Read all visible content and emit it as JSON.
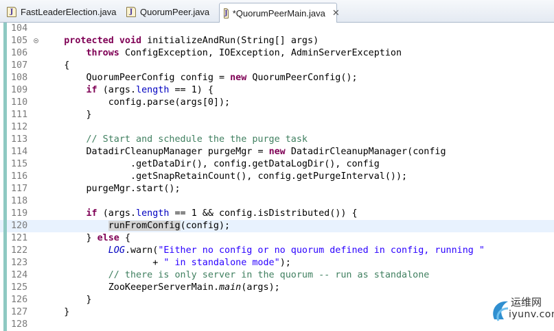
{
  "tabs": [
    {
      "label": "FastLeaderElection.java",
      "active": false
    },
    {
      "label": "QuorumPeer.java",
      "active": false
    },
    {
      "label": "*QuorumPeerMain.java",
      "active": true,
      "close": "✕"
    }
  ],
  "editor": {
    "current_line": "120",
    "fold_line": "105",
    "lines": [
      {
        "num": "104",
        "code": ""
      },
      {
        "num": "105",
        "code": "    protected void initializeAndRun(String[] args)"
      },
      {
        "num": "106",
        "code": "        throws ConfigException, IOException, AdminServerException"
      },
      {
        "num": "107",
        "code": "    {"
      },
      {
        "num": "108",
        "code": "        QuorumPeerConfig config = new QuorumPeerConfig();"
      },
      {
        "num": "109",
        "code": "        if (args.length == 1) {"
      },
      {
        "num": "110",
        "code": "            config.parse(args[0]);"
      },
      {
        "num": "111",
        "code": "        }"
      },
      {
        "num": "112",
        "code": ""
      },
      {
        "num": "113",
        "code": "        // Start and schedule the the purge task"
      },
      {
        "num": "114",
        "code": "        DatadirCleanupManager purgeMgr = new DatadirCleanupManager(config"
      },
      {
        "num": "115",
        "code": "                .getDataDir(), config.getDataLogDir(), config"
      },
      {
        "num": "116",
        "code": "                .getSnapRetainCount(), config.getPurgeInterval());"
      },
      {
        "num": "117",
        "code": "        purgeMgr.start();"
      },
      {
        "num": "118",
        "code": ""
      },
      {
        "num": "119",
        "code": "        if (args.length == 1 && config.isDistributed()) {"
      },
      {
        "num": "120",
        "code": "            runFromConfig(config);"
      },
      {
        "num": "121",
        "code": "        } else {"
      },
      {
        "num": "122",
        "code": "            LOG.warn(\"Either no config or no quorum defined in config, running \""
      },
      {
        "num": "123",
        "code": "                    + \" in standalone mode\");"
      },
      {
        "num": "124",
        "code": "            // there is only server in the quorum -- run as standalone"
      },
      {
        "num": "125",
        "code": "            ZooKeeperServerMain.main(args);"
      },
      {
        "num": "126",
        "code": "        }"
      },
      {
        "num": "127",
        "code": "    }"
      },
      {
        "num": "128",
        "code": ""
      }
    ]
  },
  "watermark": {
    "title": "运维网",
    "url": "iyunv.com"
  },
  "colors": {
    "keyword": "#7f0055",
    "comment": "#3f7f5f",
    "string": "#2a00ff",
    "field": "#0000c0",
    "change_bar": "#8ec9c2"
  }
}
